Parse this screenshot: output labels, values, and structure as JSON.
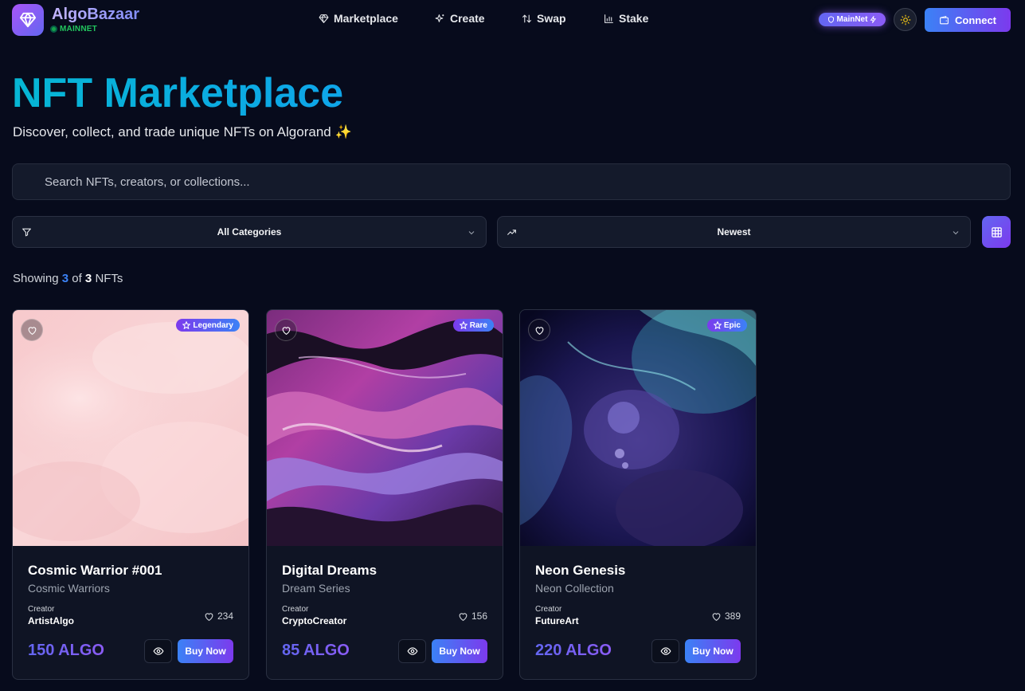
{
  "header": {
    "brand": "AlgoBazaar",
    "network_label": "MAINNET",
    "nav": [
      {
        "label": "Marketplace",
        "icon": "diamond-icon"
      },
      {
        "label": "Create",
        "icon": "sparkles-icon"
      },
      {
        "label": "Swap",
        "icon": "arrows-updown-icon"
      },
      {
        "label": "Stake",
        "icon": "bar-chart-icon"
      }
    ],
    "network_pill": "MainNet",
    "connect_label": "Connect"
  },
  "hero": {
    "title": "NFT Marketplace",
    "subtitle": "Discover, collect, and trade unique NFTs on Algorand ✨"
  },
  "search": {
    "placeholder": "Search NFTs, creators, or collections..."
  },
  "filters": {
    "category": "All Categories",
    "sort": "Newest"
  },
  "results": {
    "prefix": "Showing",
    "shown": "3",
    "mid": "of",
    "total": "3",
    "suffix": "NFTs"
  },
  "nfts": [
    {
      "name": "Cosmic Warrior #001",
      "collection": "Cosmic Warriors",
      "rarity": "Legendary",
      "creator_label": "Creator",
      "creator": "ArtistAlgo",
      "likes": "234",
      "price": "150 ALGO",
      "buy_label": "Buy Now"
    },
    {
      "name": "Digital Dreams",
      "collection": "Dream Series",
      "rarity": "Rare",
      "creator_label": "Creator",
      "creator": "CryptoCreator",
      "likes": "156",
      "price": "85 ALGO",
      "buy_label": "Buy Now"
    },
    {
      "name": "Neon Genesis",
      "collection": "Neon Collection",
      "rarity": "Epic",
      "creator_label": "Creator",
      "creator": "FutureArt",
      "likes": "389",
      "price": "220 ALGO",
      "buy_label": "Buy Now"
    }
  ],
  "colors": {
    "background": "#070b1c",
    "accent_cyan": "#06b6d4",
    "accent_purple": "#7c3aed",
    "accent_blue": "#3b82f6",
    "network_green": "#22c55e"
  }
}
